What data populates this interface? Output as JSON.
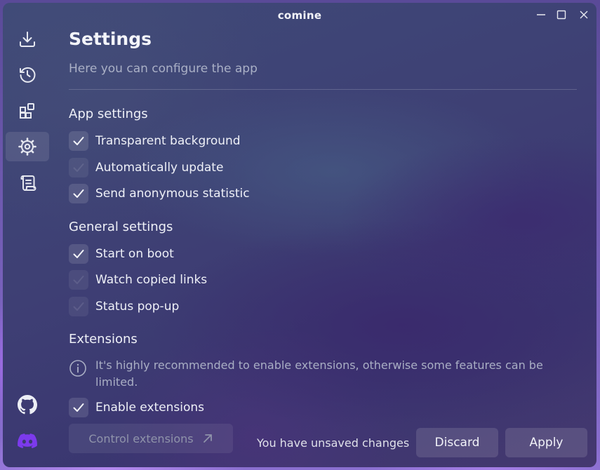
{
  "window": {
    "title": "comine",
    "controls": {
      "minimize": "minimize-icon",
      "maximize": "maximize-icon",
      "close": "close-icon"
    }
  },
  "sidebar": {
    "items": [
      {
        "name": "download",
        "icon": "download-icon",
        "active": false
      },
      {
        "name": "history",
        "icon": "history-icon",
        "active": false
      },
      {
        "name": "extensions",
        "icon": "extensions-icon",
        "active": false
      },
      {
        "name": "settings",
        "icon": "gear-icon",
        "active": true
      },
      {
        "name": "logs",
        "icon": "scroll-icon",
        "active": false
      }
    ],
    "bottom": [
      {
        "name": "github",
        "icon": "github-icon"
      },
      {
        "name": "discord",
        "icon": "discord-icon",
        "color": "#7c3aed"
      }
    ]
  },
  "page": {
    "title": "Settings",
    "subtitle": "Here you can configure the app"
  },
  "app_settings": {
    "title": "App settings",
    "options": [
      {
        "label": "Transparent background",
        "checked": true
      },
      {
        "label": "Automatically update",
        "checked": false
      },
      {
        "label": "Send anonymous statistic",
        "checked": true
      }
    ]
  },
  "general_settings": {
    "title": "General settings",
    "options": [
      {
        "label": "Start on boot",
        "checked": true
      },
      {
        "label": "Watch copied links",
        "checked": false
      },
      {
        "label": "Status pop-up",
        "checked": false
      }
    ]
  },
  "extensions": {
    "title": "Extensions",
    "info": "It's highly recommended to enable extensions, otherwise some features can be limited.",
    "enable_label": "Enable extensions",
    "enable_checked": true,
    "control_label": "Control extensions"
  },
  "footer": {
    "unsaved_text": "You have unsaved changes",
    "discard_label": "Discard",
    "apply_label": "Apply"
  }
}
